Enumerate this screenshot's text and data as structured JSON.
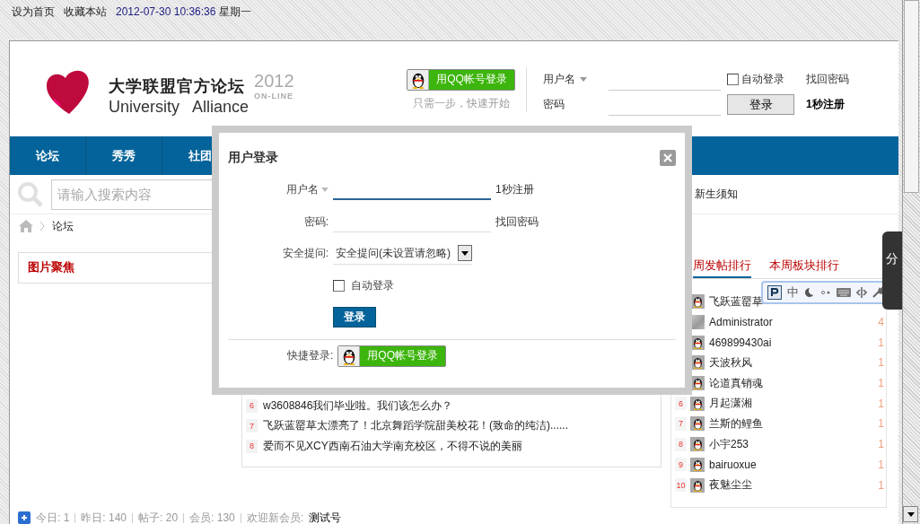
{
  "top_bar": {
    "links": [
      "设为首页",
      "收藏本站"
    ],
    "datetime": "2012-07-30 10:36:36",
    "weekday": "星期一"
  },
  "header": {
    "logo_title": "大学联盟官方论坛",
    "logo_subtitle": "University   Alliance",
    "logo_year": "2012",
    "logo_tag": "ON-LINE",
    "qq_login": "用QQ帐号登录",
    "qq_hint": "只需一步，快速开始",
    "username_label": "用户名",
    "password_label": "密码",
    "auto_login": {
      "label": "自动登录",
      "checked": false
    },
    "find_password": "找回密码",
    "login_button": "登录",
    "register": "1秒注册"
  },
  "nav": [
    "论坛",
    "秀秀",
    "社团"
  ],
  "search": {
    "placeholder": "请输入搜索内容"
  },
  "quick_links": [
    "新生须知"
  ],
  "breadcrumb": [
    "论坛"
  ],
  "focus_panel": {
    "title": "图片聚焦"
  },
  "thread_list": [
    {
      "rank": "6",
      "title": "w3608846我们毕业啦。我们该怎么办？"
    },
    {
      "rank": "7",
      "title": "飞跃蓝罂草太漂亮了！北京舞蹈学院甜美校花！(致命的纯洁)......"
    },
    {
      "rank": "8",
      "title": "爱而不见XCY西南石油大学南充校区，不得不说的美丽"
    }
  ],
  "ranking": {
    "tabs": [
      {
        "label": "周发帖排行",
        "selected": true
      },
      {
        "label": "本周板块排行",
        "selected": false
      }
    ],
    "rows": [
      {
        "name": "飞跃蓝罂草",
        "kind": "penguin"
      },
      {
        "name": "Administrator",
        "kind": "blank",
        "count": "4"
      },
      {
        "name": "469899430ai",
        "kind": "penguin",
        "count": "1"
      },
      {
        "name": "天波秋风",
        "kind": "penguin",
        "count": "1"
      },
      {
        "name": "论道真销魂",
        "kind": "penguin",
        "count": "1"
      },
      {
        "rank": "6",
        "name": "月起潇湘",
        "kind": "penguin",
        "count": "1"
      },
      {
        "rank": "7",
        "name": "兰斯的鲤鱼",
        "kind": "penguin",
        "count": "1"
      },
      {
        "rank": "8",
        "name": "小宇253",
        "kind": "penguin",
        "count": "1"
      },
      {
        "rank": "9",
        "name": "bairuoxue",
        "kind": "penguin",
        "count": "1"
      },
      {
        "rank": "10",
        "name": "夜魅尘尘",
        "kind": "penguin",
        "count": "1"
      }
    ]
  },
  "stats": [
    {
      "label": "今日:",
      "value": "1"
    },
    {
      "label": "昨日:",
      "value": "140"
    },
    {
      "label": "帖子:",
      "value": "20"
    },
    {
      "label": "会员:",
      "value": "130"
    }
  ],
  "welcome": {
    "label": "欢迎新会员:",
    "name": "测试号"
  },
  "side_tab": {
    "label": "分"
  },
  "ime_toolbar": {
    "mode": "中"
  },
  "modal": {
    "title": "用户登录",
    "username_label": "用户名",
    "register": "1秒注册",
    "password_label": "密码:",
    "find_password": "找回密码",
    "question_label": "安全提问:",
    "question_value": "安全提问(未设置请忽略)",
    "auto_login": {
      "label": "自动登录",
      "checked": false
    },
    "submit": "登录",
    "quick_label": "快捷登录:",
    "qq_login": "用QQ帐号登录"
  }
}
